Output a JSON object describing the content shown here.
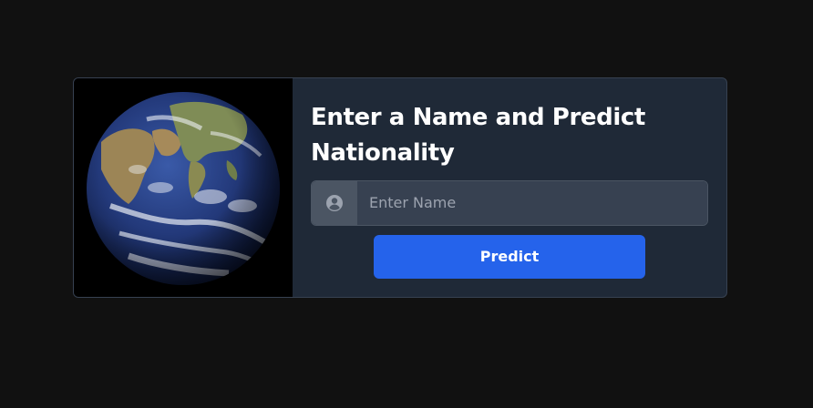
{
  "card": {
    "title": "Enter a Name and Predict Nationality",
    "image": {
      "icon": "earth-globe-icon"
    }
  },
  "form": {
    "input": {
      "icon": "user-circle-icon",
      "value": "",
      "placeholder": "Enter Name"
    },
    "predict_label": "Predict"
  },
  "colors": {
    "page_background": "#111111",
    "card_background": "#1f2937",
    "card_border": "#374151",
    "input_background": "#374151",
    "addon_background": "#4b5563",
    "button_background": "#2563eb",
    "title_text": "#ffffff",
    "placeholder_text": "#9ca3af"
  }
}
